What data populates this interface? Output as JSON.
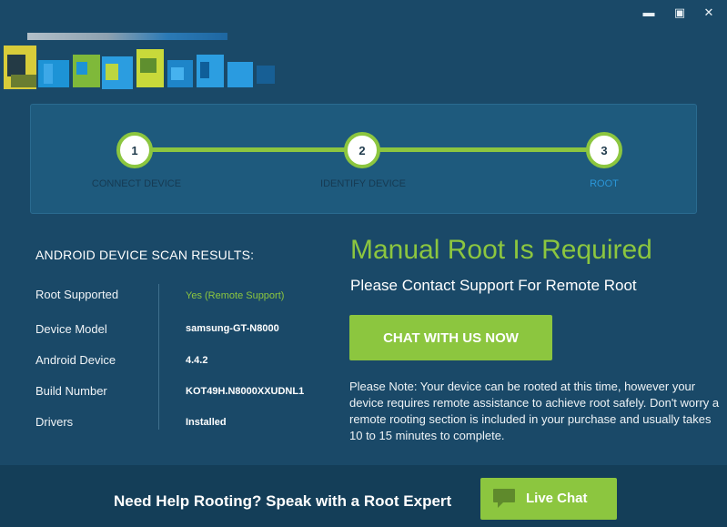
{
  "window": {
    "minimize_glyph": "▬",
    "maximize_glyph": "▣",
    "close_glyph": "✕"
  },
  "stepper": {
    "steps": [
      {
        "number": "1",
        "label": "CONNECT DEVICE",
        "state": "complete"
      },
      {
        "number": "2",
        "label": "IDENTIFY DEVICE",
        "state": "complete"
      },
      {
        "number": "3",
        "label": "ROOT",
        "state": "active"
      }
    ]
  },
  "scan": {
    "title": "ANDROID DEVICE SCAN RESULTS:",
    "rows": [
      {
        "label": "Root Supported",
        "value": "Yes (Remote Support)"
      },
      {
        "label": "Device Model",
        "value": "samsung-GT-N8000"
      },
      {
        "label": "Android Device",
        "value": "4.4.2"
      },
      {
        "label": "Build Number",
        "value": "KOT49H.N8000XXUDNL1"
      },
      {
        "label": "Drivers",
        "value": "Installed"
      }
    ]
  },
  "main": {
    "headline": "Manual Root Is Required",
    "subhead": "Please Contact Support For Remote Root",
    "chat_button": "CHAT WITH US NOW",
    "note": "Please Note: Your device can be rooted at this time, however your device requires remote assistance to achieve root safely. Don't worry a remote rooting section is included in your purchase and usually takes 10 to 15 minutes to complete."
  },
  "footer": {
    "text": "Need Help Rooting? Speak with a Root Expert",
    "live_chat": "Live Chat",
    "icon": "chat-bubble-icon"
  },
  "colors": {
    "background": "#1a4968",
    "accent_green": "#8cc63f",
    "active_blue": "#2b96d8",
    "footer": "#143e58"
  }
}
